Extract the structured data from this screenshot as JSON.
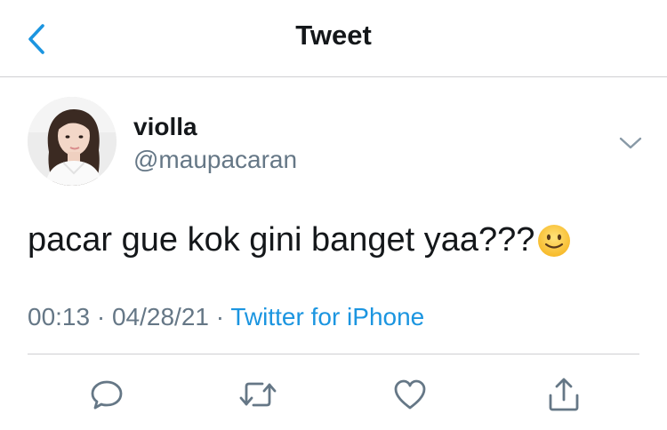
{
  "header": {
    "title": "Tweet",
    "back_icon": "chevron-left-icon"
  },
  "colors": {
    "accent": "#1b95e0",
    "text": "#14171a",
    "secondary_text": "#657786",
    "divider": "#cfcfd2"
  },
  "tweet": {
    "display_name": "violla",
    "handle": "@maupacaran",
    "text": "pacar gue kok gini banget yaa???",
    "emoji": "slightly-smiling-face",
    "time": "00:13",
    "separator": "·",
    "date": "04/28/21",
    "source": "Twitter for iPhone",
    "menu_icon": "chevron-down-icon"
  },
  "actions": [
    {
      "icon": "reply-icon"
    },
    {
      "icon": "retweet-icon"
    },
    {
      "icon": "like-icon"
    },
    {
      "icon": "share-icon"
    }
  ]
}
